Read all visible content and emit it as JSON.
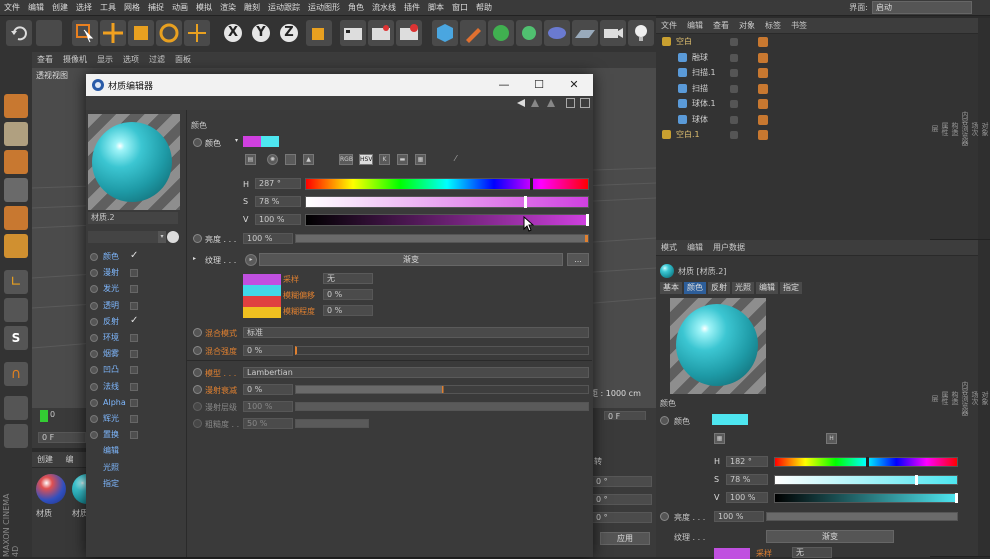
{
  "menubar": {
    "items": [
      "文件",
      "编辑",
      "创建",
      "选择",
      "工具",
      "网格",
      "捕捉",
      "动画",
      "模拟",
      "渲染",
      "雕刻",
      "运动跟踪",
      "运动图形",
      "角色",
      "流水线",
      "插件",
      "脚本",
      "窗口",
      "帮助"
    ],
    "layout_label": "界面:",
    "layout_value": "启动"
  },
  "viewport": {
    "menu": [
      "查看",
      "摄像机",
      "显示",
      "选项",
      "过滤",
      "面板"
    ],
    "label": "透视视图",
    "grid_distance": "距 : 1000 cm"
  },
  "timeline": {
    "frame_start": "0",
    "frame_field": "0 F",
    "frame_right": "0 F"
  },
  "material_manager": {
    "tabs": [
      "创建",
      "编"
    ],
    "items": [
      "材质",
      "材质"
    ]
  },
  "watermark": {
    "brand": "MAXON",
    "product": "CINEMA 4D"
  },
  "object_manager": {
    "tabs": [
      "文件",
      "编辑",
      "查看",
      "对象",
      "标签",
      "书签"
    ],
    "objects": [
      {
        "name": "空白",
        "color": "#e0c070"
      },
      {
        "name": "融球",
        "color": "#cfcfcf"
      },
      {
        "name": "扫描.1",
        "color": "#cfcfcf"
      },
      {
        "name": "扫描",
        "color": "#cfcfcf"
      },
      {
        "name": "球体.1",
        "color": "#cfcfcf"
      },
      {
        "name": "球体",
        "color": "#cfcfcf"
      },
      {
        "name": "空白.1",
        "color": "#e0c070"
      }
    ]
  },
  "attr_manager": {
    "tabs": [
      "模式",
      "编辑",
      "用户数据"
    ],
    "material_title": "材质 [材质.2]",
    "subtabs": [
      "基本",
      "颜色",
      "反射",
      "光照",
      "编辑",
      "指定"
    ],
    "section_color": "颜色",
    "color_label": "颜色",
    "color_swatch": "#4ee6f0",
    "h_label": "H",
    "h_value": "182 °",
    "h_fraction": 0.51,
    "s_label": "S",
    "s_value": "78 %",
    "s_fraction": 0.78,
    "v_label": "V",
    "v_value": "100 %",
    "v_fraction": 1.0,
    "brightness_label": "亮度 . . .",
    "brightness_value": "100 %",
    "texture_label": "纹理 . . .",
    "texture_button": "渐变",
    "sampling_label": "采样",
    "sampling_value": "无"
  },
  "right_tabs": [
    "对象",
    "场次",
    "内容浏览器",
    "构造",
    "属性",
    "层"
  ],
  "coord_panel": {
    "apply": "应用",
    "fields": [
      "0 °",
      "0 °",
      "0 °"
    ],
    "label": "转"
  },
  "dialog": {
    "title": "材质编辑器",
    "minimize": "—",
    "maximize": "☐",
    "close": "✕",
    "material_name": "材质.2",
    "channels": [
      {
        "name": "颜色",
        "checked": true,
        "has_box": true
      },
      {
        "name": "漫射",
        "checked": false,
        "has_box": true
      },
      {
        "name": "发光",
        "checked": false,
        "has_box": true
      },
      {
        "name": "透明",
        "checked": false,
        "has_box": true
      },
      {
        "name": "反射",
        "checked": true,
        "has_box": true
      },
      {
        "name": "环境",
        "checked": false,
        "has_box": true
      },
      {
        "name": "烟雾",
        "checked": false,
        "has_box": true
      },
      {
        "name": "凹凸",
        "checked": false,
        "has_box": true
      },
      {
        "name": "法线",
        "checked": false,
        "has_box": true
      },
      {
        "name": "Alpha",
        "checked": false,
        "has_box": true
      },
      {
        "name": "辉光",
        "checked": false,
        "has_box": true
      },
      {
        "name": "置换",
        "checked": false,
        "has_box": true
      },
      {
        "name": "编辑",
        "checked": false,
        "has_box": false
      },
      {
        "name": "光照",
        "checked": false,
        "has_box": false
      },
      {
        "name": "指定",
        "checked": false,
        "has_box": false
      }
    ],
    "color_section": "颜色",
    "color_label": "颜色",
    "color_swatch_a": "#d040e0",
    "color_swatch_b": "#4ee6f0",
    "mode_icons": [
      "RGB",
      "HSV",
      "K"
    ],
    "h_label": "H",
    "h_value": "287 °",
    "h_fraction": 0.8,
    "s_label": "S",
    "s_value": "78 %",
    "s_fraction": 0.78,
    "v_label": "V",
    "v_value": "100 %",
    "v_fraction": 1.0,
    "brightness_label": "亮度 . . .",
    "brightness_value": "100 %",
    "texture_label": "纹理 . . .",
    "texture_button": "渐变",
    "texture_more": "...",
    "sampling_label": "采样",
    "sampling_value": "无",
    "blur_offset_label": "模糊偏移",
    "blur_offset_value": "0 %",
    "blur_degree_label": "模糊程度",
    "blur_degree_value": "0 %",
    "gradient_colors": [
      "#c050e0",
      "#40d8e8",
      "#e04040",
      "#f0c020"
    ],
    "blend_mode_label": "混合模式",
    "blend_mode_value": "标准",
    "blend_strength_label": "混合强度",
    "blend_strength_value": "0 %",
    "model_label": "模型 . . .",
    "model_value": "Lambertian",
    "diffuse_falloff_label": "漫射衰减",
    "diffuse_falloff_value": "0 %",
    "diffuse_level_label": "漫射层级",
    "diffuse_level_value": "100 %",
    "roughness_label": "粗糙度 . .",
    "roughness_value": "50 %"
  }
}
